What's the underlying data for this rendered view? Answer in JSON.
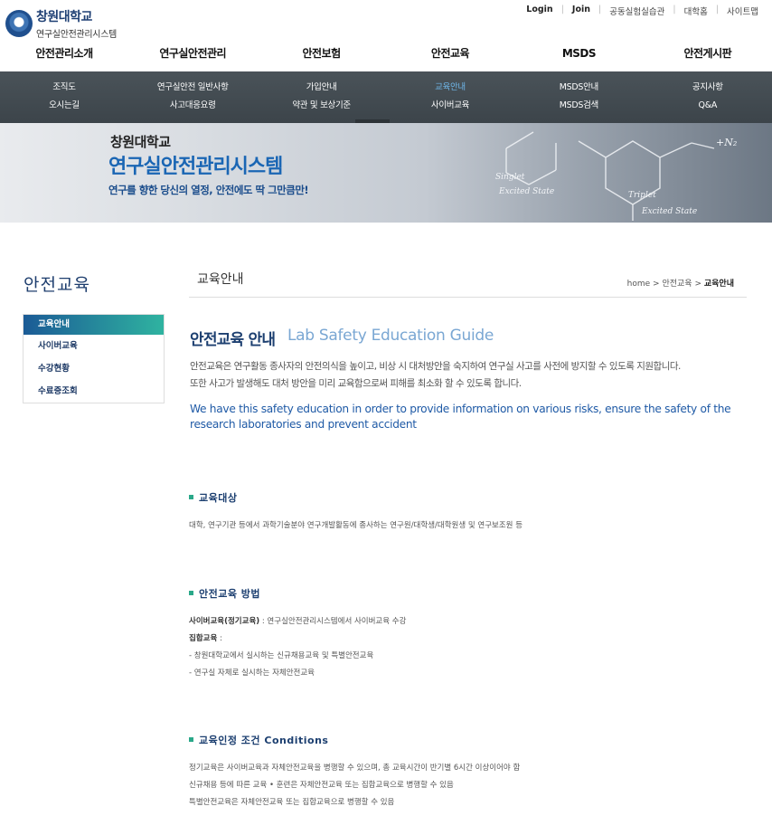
{
  "header": {
    "logo_name": "창원대학교",
    "logo_sub": "연구실안전관리시스템",
    "util_links": [
      "Login",
      "Join",
      "공동실험실습관",
      "대학홈",
      "사이트맵"
    ]
  },
  "gnb": [
    "안전관리소개",
    "연구실안전관리",
    "안전보험",
    "안전교육",
    "MSDS",
    "안전게시판"
  ],
  "subnav": {
    "row1": [
      "조직도",
      "연구실안전 일반사항",
      "가입안내",
      "교육안내",
      "MSDS안내",
      "공지사항"
    ],
    "row2": [
      "오시는길",
      "사고대응요령",
      "약관 및 보상기준",
      "사이버교육",
      "MSDS검색",
      "Q&A"
    ],
    "active": "교육안내"
  },
  "banner": {
    "line1": "창원대학교",
    "line2": "연구실안전관리시스템",
    "line3": "연구를 향한 당신의 열정, 안전에도 딱 그만큼만!"
  },
  "sidebar": {
    "title": "안전교육",
    "items": [
      {
        "label": "교육안내",
        "active": true
      },
      {
        "label": "사이버교육",
        "active": false
      },
      {
        "label": "수강현황",
        "active": false
      },
      {
        "label": "수료증조회",
        "active": false
      }
    ]
  },
  "content": {
    "title": "교육안내",
    "breadcrumb": {
      "home": "home",
      "sep": ">",
      "mid": "안전교육",
      "current": "교육안내"
    },
    "heading": "안전교육 안내",
    "heading_en": "Lab Safety Education Guide",
    "intro_1": "안전교육은 연구활동 종사자의 안전의식을 높이고, 비상 시 대처방안을 숙지하여 연구실 사고를 사전에 방지할 수 있도록 지원합니다.",
    "intro_2": "또한 사고가 발생해도 대처 방안을 미리 교육함으로써 피해를 최소화 할 수 있도록 합니다.",
    "intro_en": "We have this safety education in order to provide information on various risks, ensure the safety of the research laboratories and prevent accident",
    "sec1_title": "교육대상",
    "sec1_text": "대학, 연구기관 등에서 과학기술분야 연구개발활동에 종사하는 연구원/대학생/대학원생 및 연구보조원 등",
    "sec2_title": "안전교육 방법",
    "sec2_cyber_label": "사이버교육(정기교육)",
    "sec2_cyber_text": " : 연구실안전관리시스템에서 사이버교육 수강",
    "sec2_group_label": "집합교육",
    "sec2_group_suffix": " :",
    "sec2_item1": "- 창원대학교에서 실시하는 신규채용교육 및 특별안전교육",
    "sec2_item2": "- 연구실 자체로 실시하는 자체안전교육",
    "sec3_title": "교육인정 조건 Conditions",
    "sec3_line1": "정기교육은 사이버교육과 자체안전교육을 병행할 수 있으며, 총 교육시간이 반기별 6시간 이상이어야 함",
    "sec3_line2": "신규채용 등에 따른 교육 • 훈련은 자체안전교육 또는 집합교육으로 병행할 수 있음",
    "sec3_line3": "특별안전교육은 자체안전교육 또는 집합교육으로 병행할 수 있음"
  }
}
